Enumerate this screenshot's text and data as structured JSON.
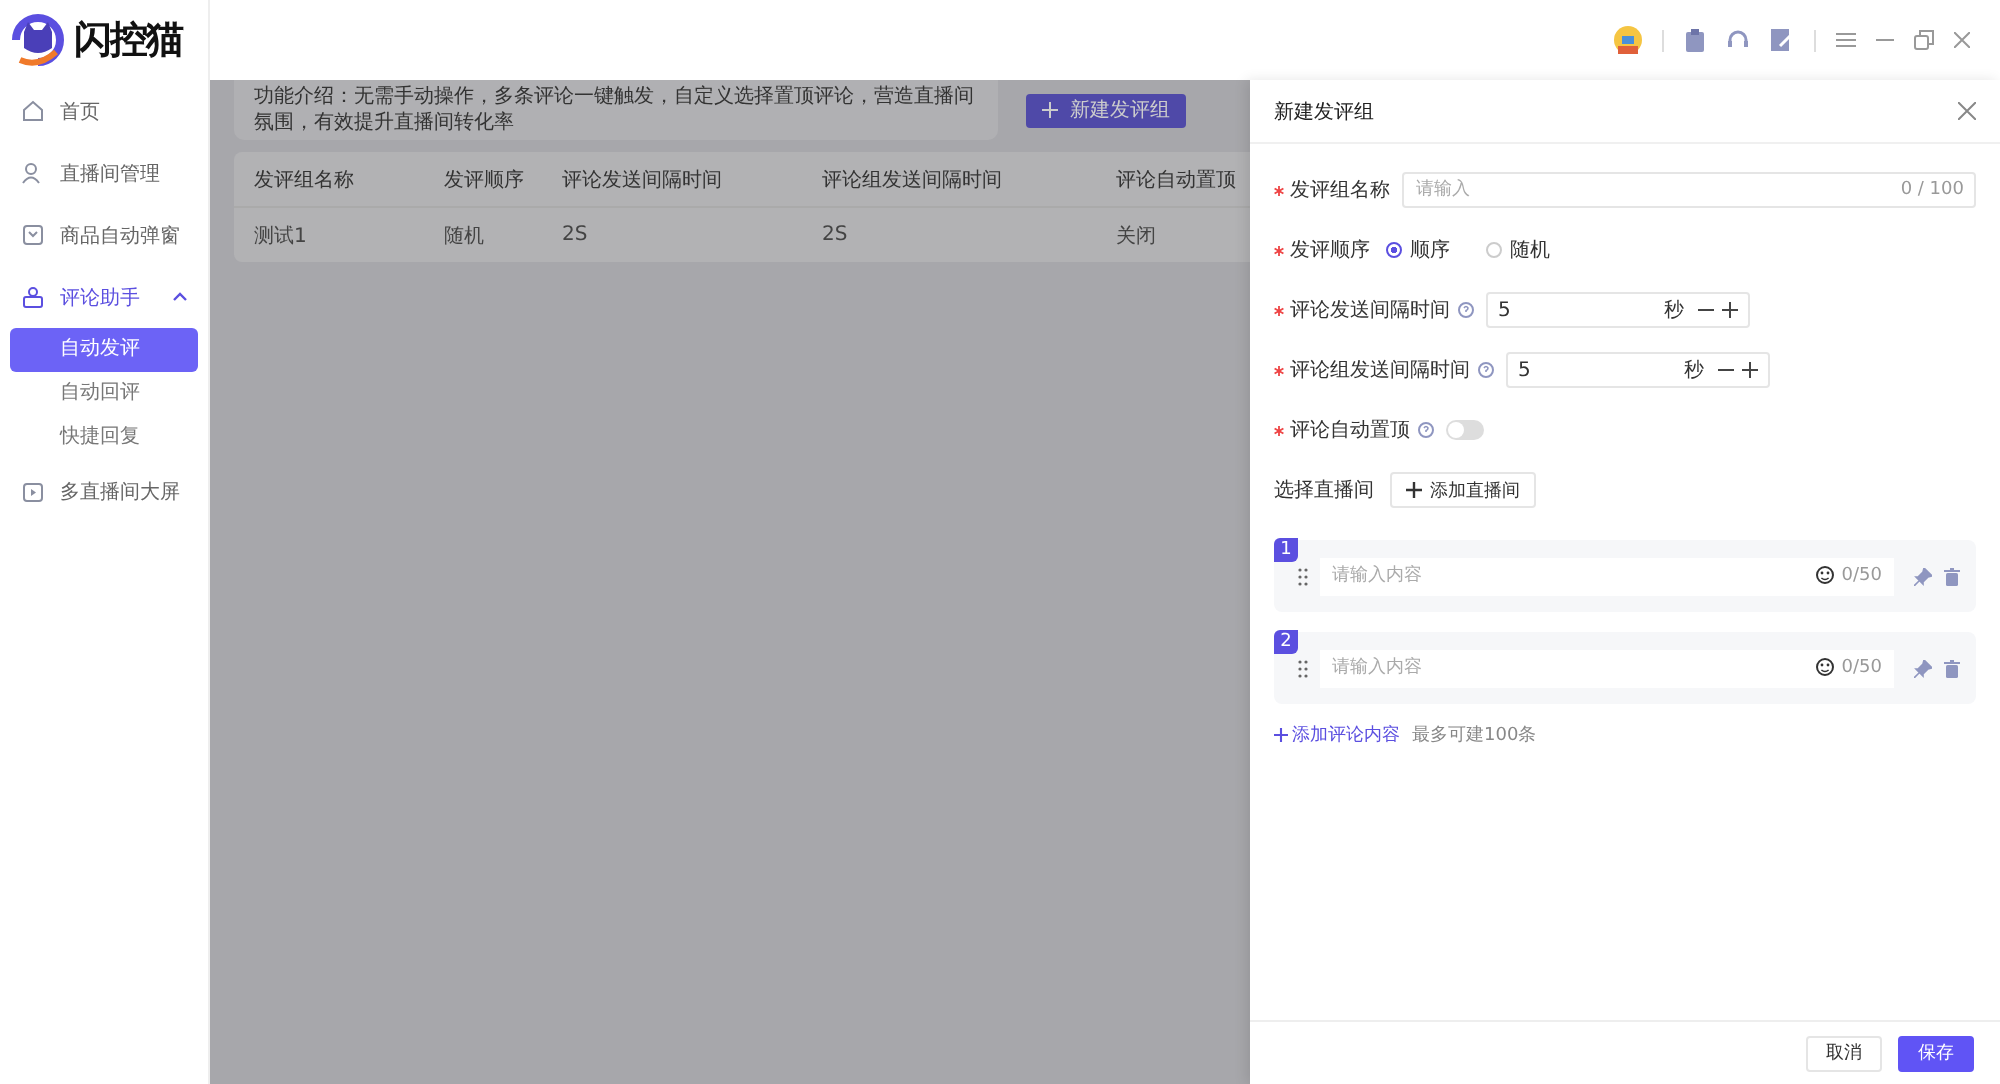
{
  "app": {
    "logo_text": "闪控猫"
  },
  "sidebar": {
    "items": [
      {
        "label": "首页",
        "expanded": false
      },
      {
        "label": "直播间管理",
        "expanded": false
      },
      {
        "label": "商品自动弹窗",
        "expanded": false
      },
      {
        "label": "评论助手",
        "expanded": true,
        "children": [
          {
            "label": "自动发评",
            "selected": true
          },
          {
            "label": "自动回评",
            "selected": false
          },
          {
            "label": "快捷回复",
            "selected": false
          }
        ]
      },
      {
        "label": "多直播间大屏",
        "expanded": false
      }
    ]
  },
  "main": {
    "notice": "功能介绍：无需手动操作，多条评论一键触发，自定义选择置顶评论，营造直播间氛围，有效提升直播间转化率",
    "new_button": "新建发评组",
    "table": {
      "columns": [
        "发评组名称",
        "发评顺序",
        "评论发送间隔时间",
        "评论组发送间隔时间",
        "评论自动置顶"
      ],
      "rows": [
        [
          "测试1",
          "随机",
          "2S",
          "2S",
          "关闭"
        ]
      ]
    }
  },
  "drawer": {
    "title": "新建发评组",
    "fields": [
      {
        "kind": "text",
        "label": "发评组名称",
        "required": true,
        "placeholder": "请输入",
        "counter": "0 / 100"
      },
      {
        "kind": "radio",
        "label": "发评顺序",
        "required": true,
        "options": [
          {
            "label": "顺序",
            "selected": true
          },
          {
            "label": "随机",
            "selected": false
          }
        ]
      },
      {
        "kind": "number",
        "label": "评论发送间隔时间",
        "required": true,
        "help": true,
        "value": "5",
        "unit": "秒"
      },
      {
        "kind": "number",
        "label": "评论组发送间隔时间",
        "required": true,
        "help": true,
        "value": "5",
        "unit": "秒"
      },
      {
        "kind": "switch",
        "label": "评论自动置顶",
        "required": true,
        "help": true,
        "on": false
      },
      {
        "kind": "add",
        "label": "选择直播间",
        "required": false,
        "button": "添加直播间"
      }
    ],
    "comments": [
      {
        "index": "1",
        "placeholder": "请输入内容",
        "counter": "0/50"
      },
      {
        "index": "2",
        "placeholder": "请输入内容",
        "counter": "0/50"
      }
    ],
    "add_link": "添加评论内容",
    "add_hint": "最多可建100条",
    "buttons": [
      {
        "label": "取消",
        "kind": "secondary"
      },
      {
        "label": "保存",
        "kind": "primary"
      }
    ]
  }
}
